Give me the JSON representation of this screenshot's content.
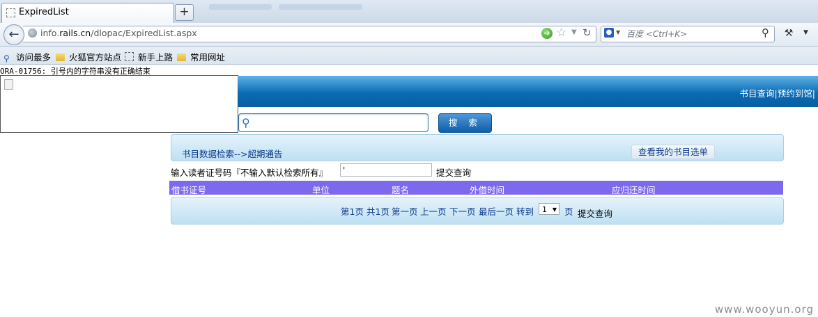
{
  "browser": {
    "tab_title": "ExpiredList",
    "newtab_label": "+",
    "url_host_prefix": "info.",
    "url_host_bold": "rails.cn",
    "url_path": "/dlopac/ExpiredList.aspx",
    "search_placeholder": "百度 <Ctrl+K>"
  },
  "bookmarks": [
    "访问最多",
    "火狐官方站点",
    "新手上路",
    "常用网址"
  ],
  "error_message": "ORA-01756: 引号内的字符串没有正确结束",
  "header": {
    "links": [
      "书目查询",
      "预约到馆"
    ],
    "separator": "|"
  },
  "search": {
    "button_label": "搜 索",
    "value": ""
  },
  "breadcrumb": "书目数据检索-->超期通告",
  "my_list_button": "查看我的书目选单",
  "reader_form": {
    "prompt": "输入读者证号码『不输入默认检索所有』",
    "value": "'",
    "submit": "提交查询"
  },
  "table": {
    "columns": [
      "借书证号",
      "单位",
      "题名",
      "外借时间",
      "应归还时间"
    ]
  },
  "pager": {
    "current": "第1页",
    "total": "共1页",
    "first": "第一页",
    "prev": "上一页",
    "next": "下一页",
    "last": "最后一页",
    "goto": "转到",
    "page_select": "1",
    "page_unit": "页",
    "submit": "提交查询"
  },
  "watermark": "www.wooyun.org",
  "colors": {
    "banner": "#0b6bb3",
    "table_header": "#7c69ee",
    "link": "#0c3c8f"
  }
}
